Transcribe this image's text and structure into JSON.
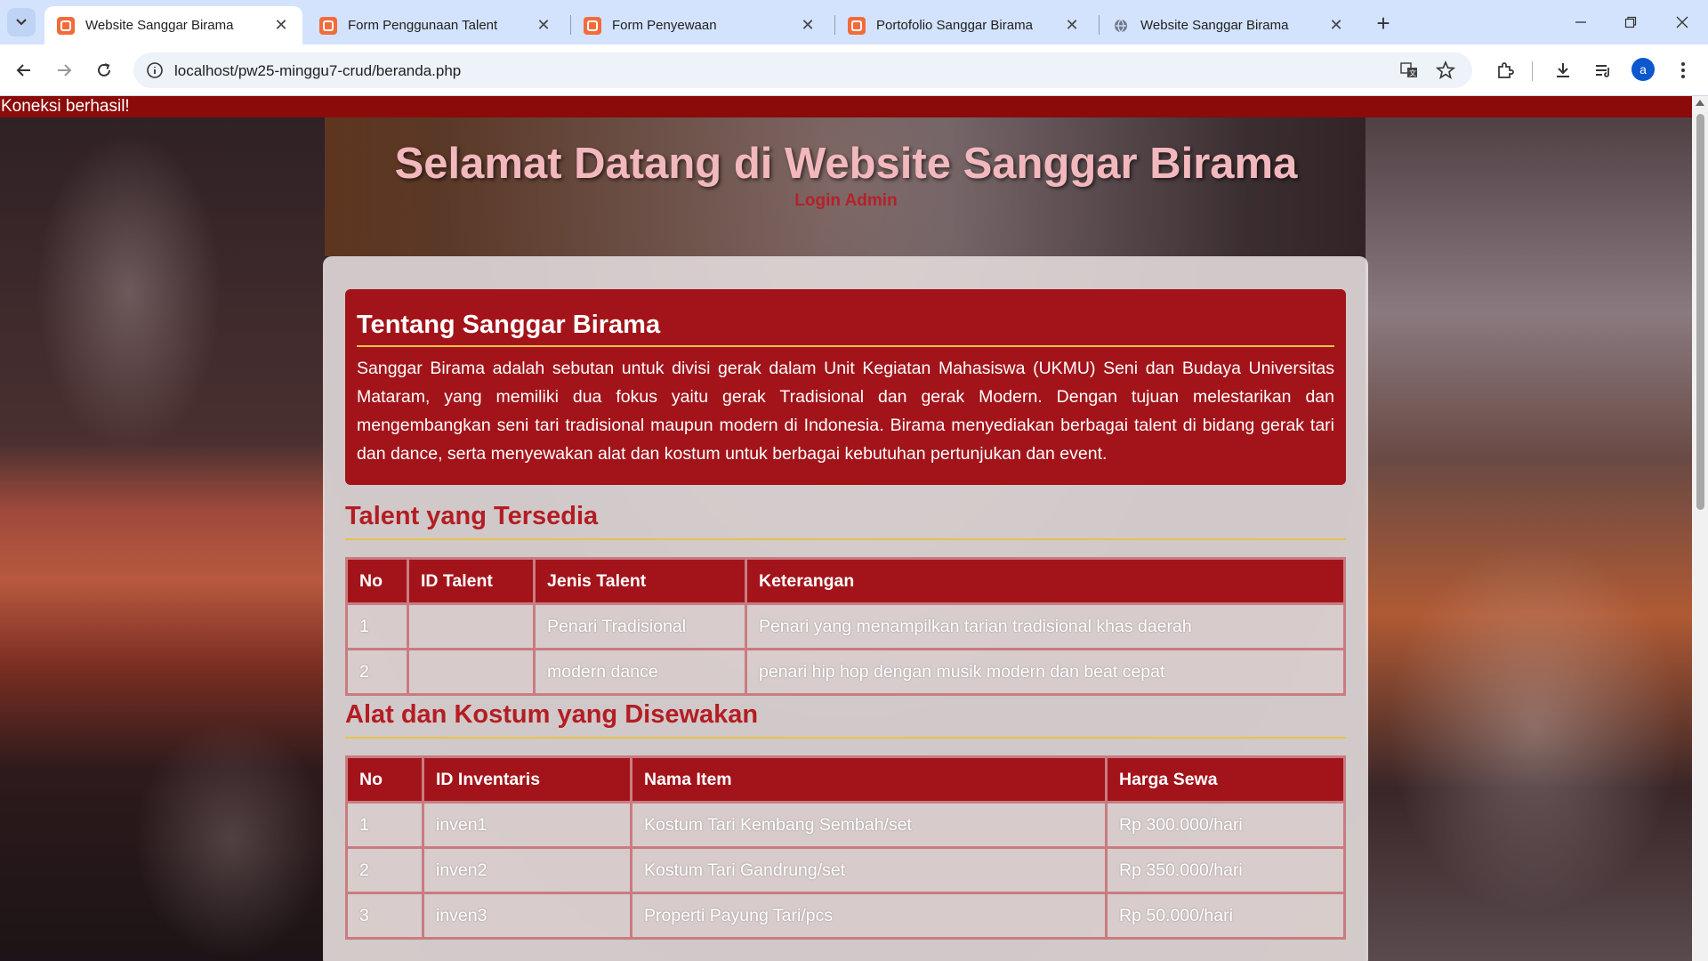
{
  "browser": {
    "tabs": [
      {
        "title": "Website Sanggar Birama",
        "active": true,
        "favicon": "xampp-icon"
      },
      {
        "title": "Form Penggunaan Talent",
        "active": false,
        "favicon": "xampp-icon"
      },
      {
        "title": "Form Penyewaan",
        "active": false,
        "favicon": "xampp-icon"
      },
      {
        "title": "Portofolio Sanggar Birama",
        "active": false,
        "favicon": "xampp-icon"
      },
      {
        "title": "Website Sanggar Birama",
        "active": false,
        "favicon": "globe-icon"
      }
    ],
    "url": "localhost/pw25-minggu7-crud/beranda.php",
    "profile_initial": "a"
  },
  "page": {
    "alert": "Koneksi berhasil!",
    "title": "Selamat Datang di Website Sanggar Birama",
    "login_link": "Login Admin",
    "about": {
      "heading": "Tentang Sanggar Birama",
      "text": "Sanggar Birama adalah sebutan untuk divisi gerak dalam Unit Kegiatan Mahasiswa (UKMU) Seni dan Budaya Universitas Mataram, yang memiliki dua fokus yaitu gerak Tradisional dan gerak Modern. Dengan tujuan melestarikan dan mengembangkan seni tari tradisional maupun modern di Indonesia. Birama menyediakan berbagai talent di bidang gerak tari dan dance, serta menyewakan alat dan kostum untuk berbagai kebutuhan pertunjukan dan event."
    },
    "talent": {
      "heading": "Talent yang Tersedia",
      "columns": [
        "No",
        "ID Talent",
        "Jenis Talent",
        "Keterangan"
      ],
      "rows": [
        [
          "1",
          "",
          "Penari Tradisional",
          "Penari yang menampilkan tarian tradisional khas daerah"
        ],
        [
          "2",
          "",
          "modern dance",
          "penari hip hop dengan musik modern dan beat cepat"
        ]
      ]
    },
    "inventaris": {
      "heading": "Alat dan Kostum yang Disewakan",
      "columns": [
        "No",
        "ID Inventaris",
        "Nama Item",
        "Harga Sewa"
      ],
      "rows": [
        [
          "1",
          "inven1",
          "Kostum Tari Kembang Sembah/set",
          "Rp 300.000/hari"
        ],
        [
          "2",
          "inven2",
          "Kostum Tari Gandrung/set",
          "Rp 350.000/hari"
        ],
        [
          "3",
          "inven3",
          "Properti Payung Tari/pcs",
          "Rp 50.000/hari"
        ]
      ]
    }
  }
}
